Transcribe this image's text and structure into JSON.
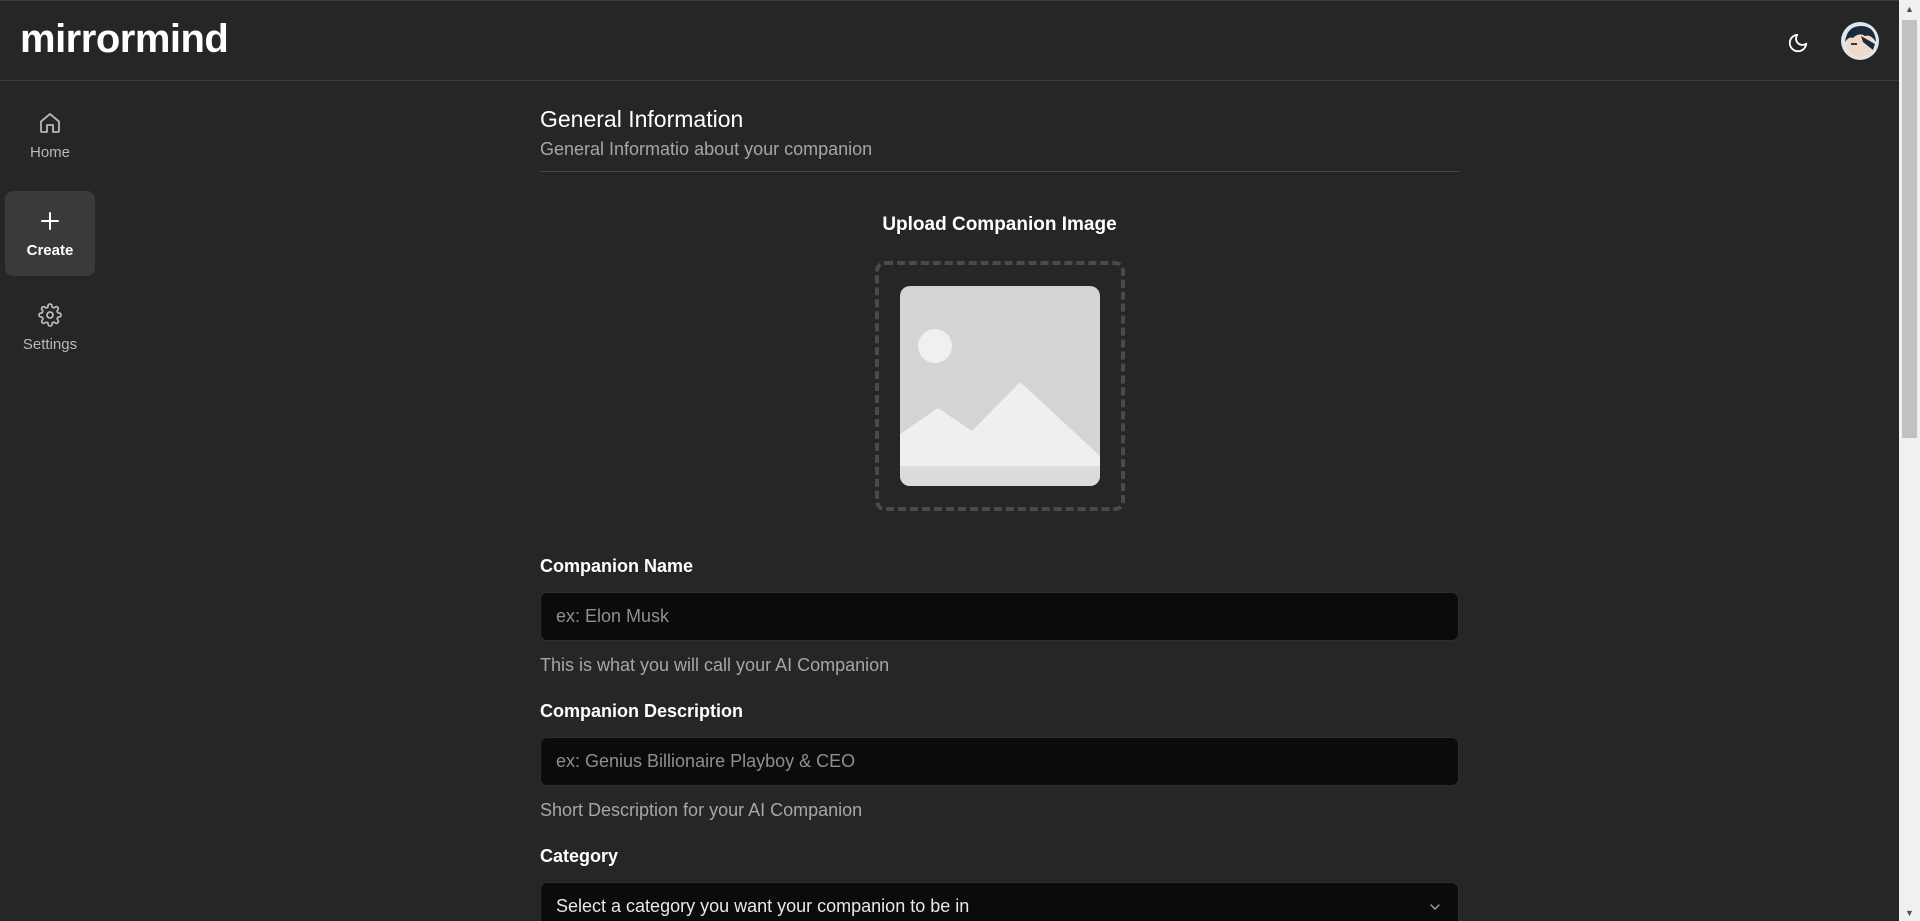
{
  "app": {
    "logo": "mirrormind"
  },
  "header": {
    "theme_icon": "moon-icon",
    "avatar_icon": "user-avatar"
  },
  "sidebar": {
    "items": [
      {
        "label": "Home",
        "icon": "home-icon",
        "active": false
      },
      {
        "label": "Create",
        "icon": "plus-icon",
        "active": true
      },
      {
        "label": "Settings",
        "icon": "gear-icon",
        "active": false
      }
    ]
  },
  "form": {
    "section_title": "General Information",
    "section_subtitle": "General Informatio about your companion",
    "upload_title": "Upload Companion Image",
    "name": {
      "label": "Companion Name",
      "placeholder": "ex: Elon Musk",
      "value": "",
      "help": "This is what you will call your AI Companion"
    },
    "description": {
      "label": "Companion Description",
      "placeholder": "ex: Genius Billionaire Playboy & CEO",
      "value": "",
      "help": "Short Description for your AI Companion"
    },
    "category": {
      "label": "Category",
      "selected": "Select a category you want your companion to be in"
    }
  },
  "colors": {
    "background": "#262626",
    "input_bg": "#0b0b0b",
    "active_nav": "#3a3a3a",
    "muted_text": "#a6a6a6"
  }
}
